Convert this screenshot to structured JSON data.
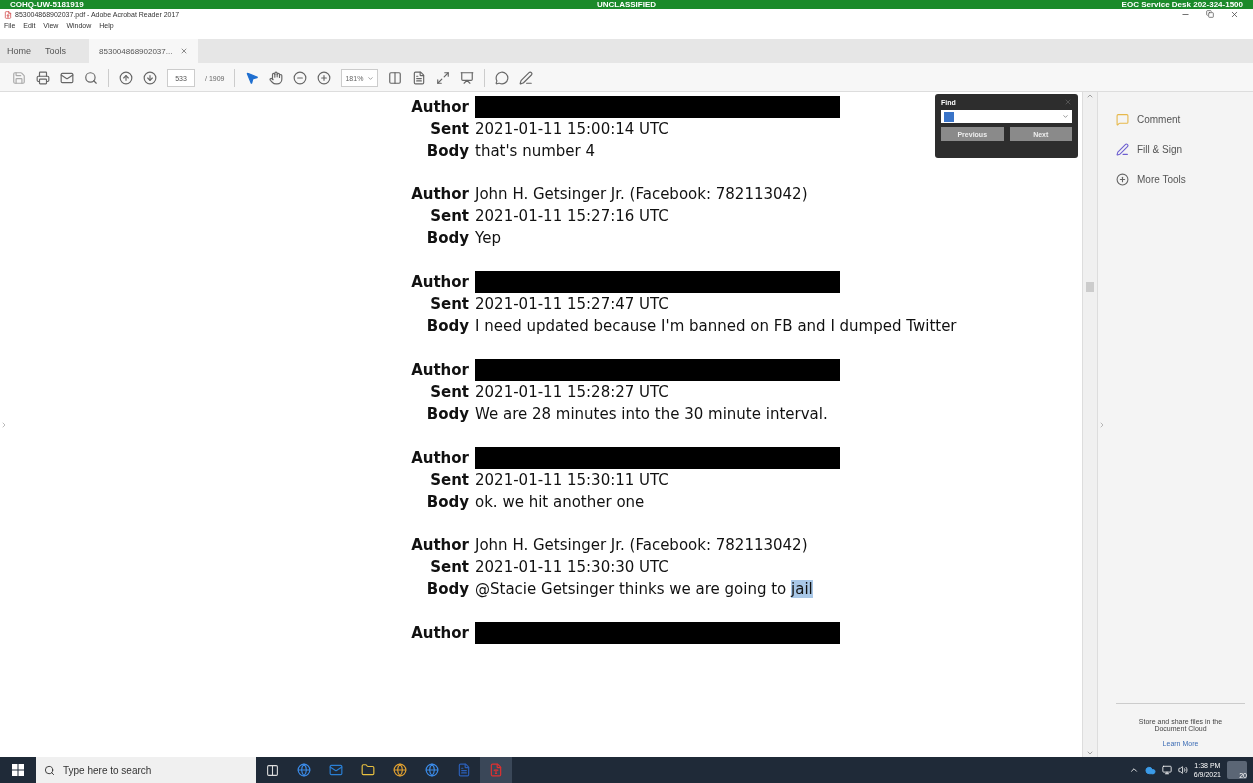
{
  "banner": {
    "left": "COHQ-UW-5181919",
    "center": "UNCLASSIFIED",
    "right": "EOC Service Desk 202-324-1500"
  },
  "window": {
    "title": "853004868902037.pdf - Adobe Acrobat Reader 2017"
  },
  "menu": [
    "File",
    "Edit",
    "View",
    "Window",
    "Help"
  ],
  "tabs": [
    {
      "label": "Home",
      "kind": "nav"
    },
    {
      "label": "Tools",
      "kind": "nav"
    },
    {
      "label": "853004868902037...",
      "kind": "doc"
    }
  ],
  "toolbar": {
    "page": "533",
    "page_count": "/ 1909",
    "zoom": "181%"
  },
  "find": {
    "title": "Find",
    "buttons": [
      "Previous",
      "Next"
    ]
  },
  "messages": [
    {
      "kind": "redacted",
      "author_label": "Author",
      "sent_label": "Sent",
      "sent": "2021-01-11 15:00:14 UTC",
      "body_label": "Body",
      "body": "that's number 4"
    },
    {
      "kind": "named",
      "author_label": "Author",
      "author": "John H. Getsinger Jr. (Facebook: 782113042)",
      "sent_label": "Sent",
      "sent": "2021-01-11 15:27:16 UTC",
      "body_label": "Body",
      "body": "Yep"
    },
    {
      "kind": "redacted",
      "author_label": "Author",
      "sent_label": "Sent",
      "sent": "2021-01-11 15:27:47 UTC",
      "body_label": "Body",
      "body": "I need updated because I'm banned on FB and I dumped Twitter"
    },
    {
      "kind": "redacted",
      "author_label": "Author",
      "sent_label": "Sent",
      "sent": "2021-01-11 15:28:27 UTC",
      "body_label": "Body",
      "body": "We are 28 minutes into the 30 minute interval."
    },
    {
      "kind": "redacted",
      "author_label": "Author",
      "sent_label": "Sent",
      "sent": "2021-01-11 15:30:11 UTC",
      "body_label": "Body",
      "body": "ok. we hit another one"
    },
    {
      "kind": "named",
      "author_label": "Author",
      "author": "John H. Getsinger Jr. (Facebook: 782113042)",
      "sent_label": "Sent",
      "sent": "2021-01-11 15:30:30 UTC",
      "body_label": "Body",
      "body": "@Stacie Getsinger thinks we are going to ",
      "highlight": "jail"
    },
    {
      "kind": "redacted",
      "author_label": "Author"
    }
  ],
  "tools": [
    {
      "label": "Comment",
      "kind": "comment"
    },
    {
      "label": "Fill & Sign",
      "kind": "sign"
    },
    {
      "label": "More Tools",
      "kind": "more"
    }
  ],
  "cloud": {
    "text": "Store and share files in the Document Cloud",
    "link": "Learn More"
  },
  "taskbar": {
    "search_placeholder": "Type here to search",
    "time": "1:38 PM",
    "date": "6/9/2021",
    "notifications": "20"
  }
}
